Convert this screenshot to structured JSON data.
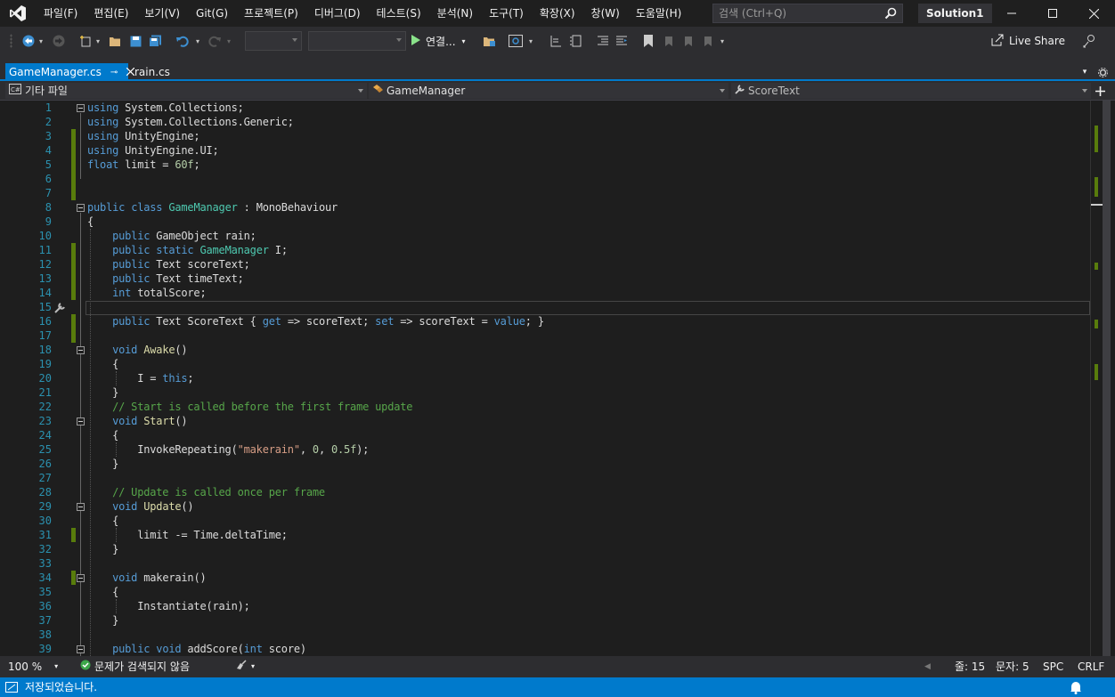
{
  "menu": [
    "파일(F)",
    "편집(E)",
    "보기(V)",
    "Git(G)",
    "프로젝트(P)",
    "디버그(D)",
    "테스트(S)",
    "분석(N)",
    "도구(T)",
    "확장(X)",
    "창(W)",
    "도움말(H)"
  ],
  "search": {
    "placeholder": "검색 (Ctrl+Q)"
  },
  "solution_name": "Solution1",
  "toolbar": {
    "run_label": "연결...",
    "live_share": "Live Share"
  },
  "tabs": [
    {
      "label": "GameManager.cs",
      "active": true
    },
    {
      "label": "rain.cs",
      "active": false
    }
  ],
  "nav": {
    "project": "기타 파일",
    "class": "GameManager",
    "member": "ScoreText"
  },
  "editor": {
    "line_numbers": [
      "1",
      "2",
      "3",
      "4",
      "5",
      "6",
      "7",
      "8",
      "9",
      "10",
      "11",
      "12",
      "13",
      "14",
      "15",
      "16",
      "17",
      "18",
      "19",
      "20",
      "21",
      "22",
      "23",
      "24",
      "25",
      "26",
      "27",
      "28",
      "29",
      "30",
      "31",
      "32",
      "33",
      "34",
      "35",
      "36",
      "37",
      "38",
      "39"
    ],
    "current_line": 15
  },
  "edstatus": {
    "zoom": "100 %",
    "issues": "문제가 검색되지 않음",
    "line": "줄: 15",
    "col": "문자: 5",
    "spc": "SPC",
    "crlf": "CRLF"
  },
  "statusbar": {
    "message": "저장되었습니다."
  },
  "colors": {
    "accent": "#007acc",
    "keyword": "#569cd6",
    "type": "#4ec9b0",
    "string": "#d69d85",
    "comment": "#57a64a",
    "changed": "#587c0c"
  }
}
